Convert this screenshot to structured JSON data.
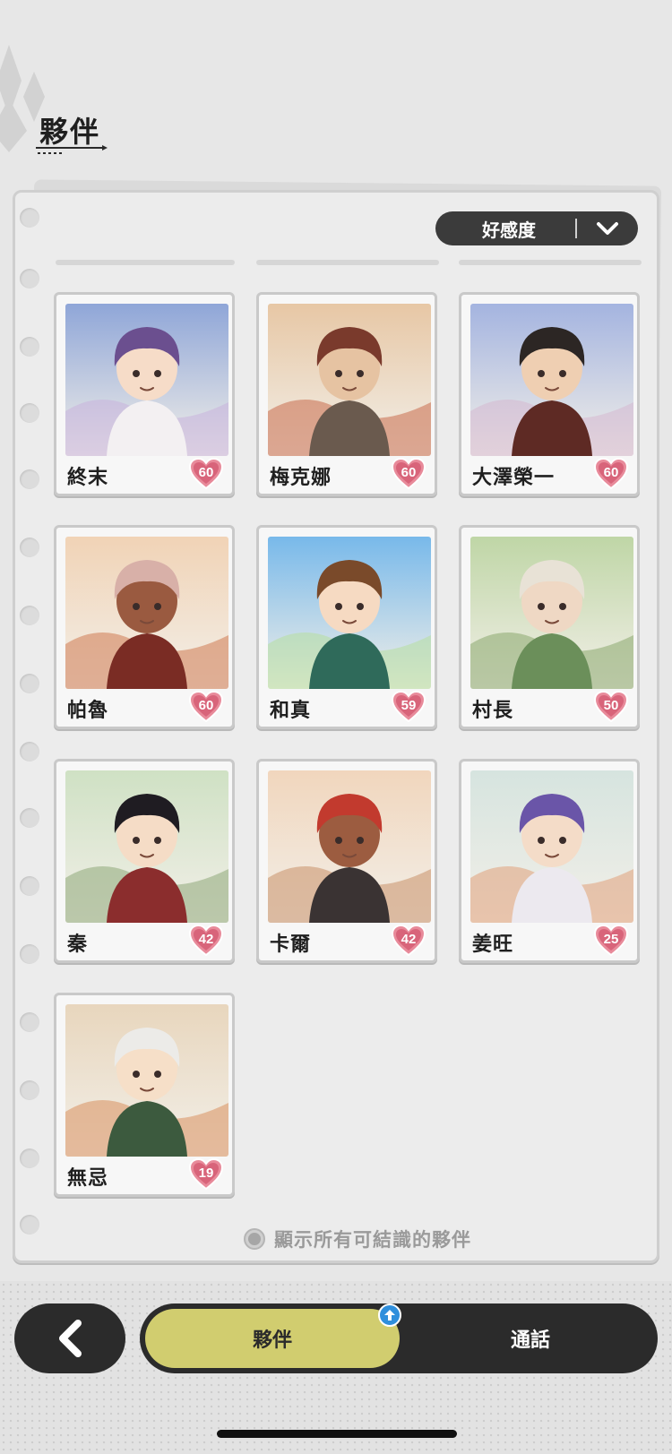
{
  "header": {
    "title": "夥伴"
  },
  "sort": {
    "label": "好感度"
  },
  "partners": [
    {
      "name": "終末",
      "affinity": "60",
      "sky": "#8fa6d8",
      "bg2": "#c9b3dc",
      "hair": "#6b4f8f",
      "skin": "#f6dcc8",
      "cloth": "#f3f0f2"
    },
    {
      "name": "梅克娜",
      "affinity": "60",
      "sky": "#e7c7a5",
      "bg2": "#c86b4d",
      "hair": "#7a3a2c",
      "skin": "#e6c3a2",
      "cloth": "#6a5a4e"
    },
    {
      "name": "大澤榮一",
      "affinity": "60",
      "sky": "#a4b4e0",
      "bg2": "#d6b8cf",
      "hair": "#2c2624",
      "skin": "#efcfb2",
      "cloth": "#5e2a24"
    },
    {
      "name": "帕魯",
      "affinity": "60",
      "sky": "#f1d3b6",
      "bg2": "#cf7a52",
      "hair": "#d8b0a8",
      "skin": "#9a5a40",
      "cloth": "#7a2c24"
    },
    {
      "name": "和真",
      "affinity": "59",
      "sky": "#78b9ea",
      "bg2": "#b6de9e",
      "hair": "#7a4a2a",
      "skin": "#f6dac2",
      "cloth": "#2f6a5a"
    },
    {
      "name": "村長",
      "affinity": "50",
      "sky": "#bfd6a6",
      "bg2": "#8aa86e",
      "hair": "#e8e2d6",
      "skin": "#efd8c4",
      "cloth": "#6b8f5a"
    },
    {
      "name": "秦",
      "affinity": "42",
      "sky": "#cfe1c4",
      "bg2": "#8ea878",
      "hair": "#1f1c22",
      "skin": "#f5dcc6",
      "cloth": "#8b2d2d"
    },
    {
      "name": "卡爾",
      "affinity": "42",
      "sky": "#f1d6bd",
      "bg2": "#c98f68",
      "hair": "#c23a2e",
      "skin": "#9c5c40",
      "cloth": "#3a3333"
    },
    {
      "name": "姜旺",
      "affinity": "25",
      "sky": "#d6e4df",
      "bg2": "#e0a07a",
      "hair": "#6a55a8",
      "skin": "#f4dcc8",
      "cloth": "#ece9ef"
    },
    {
      "name": "無忌",
      "affinity": "19",
      "sky": "#e8d6bd",
      "bg2": "#d9905e",
      "hair": "#ecebe8",
      "skin": "#f6dfc8",
      "cloth": "#3c5a3e"
    }
  ],
  "show_all": {
    "label": "顯示所有可結識的夥伴"
  },
  "tabs": {
    "partners": "夥伴",
    "calls": "通話"
  }
}
